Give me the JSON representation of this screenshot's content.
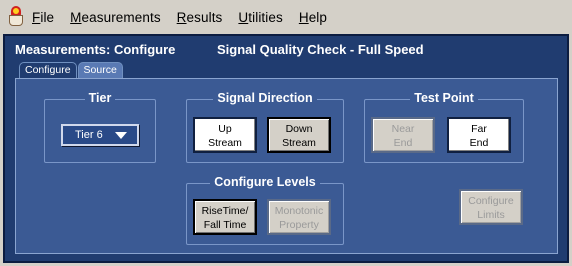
{
  "menu": {
    "items": [
      {
        "label": "File",
        "key": "F"
      },
      {
        "label": "Measurements",
        "key": "M"
      },
      {
        "label": "Results",
        "key": "R"
      },
      {
        "label": "Utilities",
        "key": "U"
      },
      {
        "label": "Help",
        "key": "H"
      }
    ]
  },
  "header": {
    "title": "Measurements: Configure",
    "subtitle": "Signal Quality Check  - Full Speed"
  },
  "tabs": [
    {
      "label": "Configure",
      "active": false
    },
    {
      "label": "Source",
      "active": true
    }
  ],
  "tier": {
    "title": "Tier",
    "selected": "Tier 6"
  },
  "signal_direction": {
    "title": "Signal Direction",
    "up": [
      "Up",
      "Stream"
    ],
    "down": [
      "Down",
      "Stream"
    ]
  },
  "test_point": {
    "title": "Test Point",
    "near": [
      "Near",
      "End"
    ],
    "far": [
      "Far",
      "End"
    ]
  },
  "configure_levels": {
    "title": "Configure Levels",
    "rise": [
      "RiseTime/",
      "Fall Time"
    ],
    "mono": [
      "Monotonic",
      "Property"
    ]
  },
  "configure_limits": [
    "Configure",
    "Limits"
  ],
  "colors": {
    "window_bg": "#203c70",
    "panel_bg": "#3b5a94",
    "menubar_bg": "#d4d0c8"
  }
}
